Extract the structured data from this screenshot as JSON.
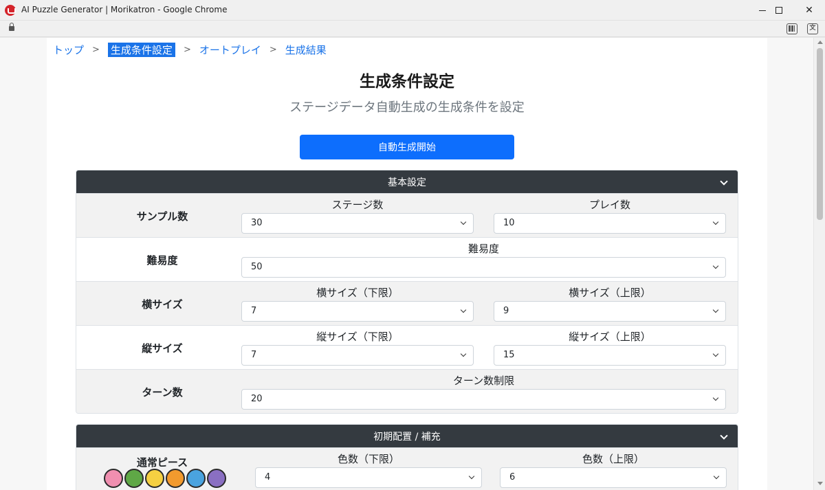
{
  "window": {
    "title": "AI Puzzle Generator | Morikatron - Google Chrome",
    "minimize": "—",
    "maximize": "☐",
    "close": "✕"
  },
  "breadcrumb": [
    "トップ",
    "生成条件設定",
    "オートプレイ",
    "生成結果"
  ],
  "breadcrumb_sep": ">",
  "page": {
    "title": "生成条件設定",
    "subtitle": "ステージデータ自動生成の生成条件を設定",
    "start_button": "自動生成開始"
  },
  "panels": {
    "basic": {
      "header": "基本設定",
      "rows": [
        {
          "label": "サンプル数",
          "fields": [
            {
              "label": "ステージ数",
              "value": "30"
            },
            {
              "label": "プレイ数",
              "value": "10"
            }
          ]
        },
        {
          "label": "難易度",
          "fields": [
            {
              "label": "難易度",
              "value": "50"
            }
          ]
        },
        {
          "label": "横サイズ",
          "fields": [
            {
              "label": "横サイズ（下限）",
              "value": "7"
            },
            {
              "label": "横サイズ（上限）",
              "value": "9"
            }
          ]
        },
        {
          "label": "縦サイズ",
          "fields": [
            {
              "label": "縦サイズ（下限）",
              "value": "7"
            },
            {
              "label": "縦サイズ（上限）",
              "value": "15"
            }
          ]
        },
        {
          "label": "ターン数",
          "fields": [
            {
              "label": "ターン数制限",
              "value": "20"
            }
          ]
        }
      ]
    },
    "initial": {
      "header": "初期配置 / 補充",
      "rows": [
        {
          "label": "通常ピース",
          "fields": [
            {
              "label": "色数（下限）",
              "value": "4"
            },
            {
              "label": "色数（上限）",
              "value": "6"
            }
          ]
        }
      ],
      "piece_icons": [
        {
          "name": "pink-heart-piece-icon",
          "color": "#f08fb0"
        },
        {
          "name": "green-leaf-piece-icon",
          "color": "#5fa846"
        },
        {
          "name": "yellow-face-piece-icon",
          "color": "#f5d042"
        },
        {
          "name": "orange-flame-piece-icon",
          "color": "#f29a2e"
        },
        {
          "name": "blue-water-piece-icon",
          "color": "#4aa3df"
        },
        {
          "name": "purple-crown-piece-icon",
          "color": "#8a6fc2"
        }
      ]
    }
  },
  "colors": {
    "accent": "#1a73e8",
    "button": "#0d6efd",
    "panel_header": "#343a40"
  }
}
